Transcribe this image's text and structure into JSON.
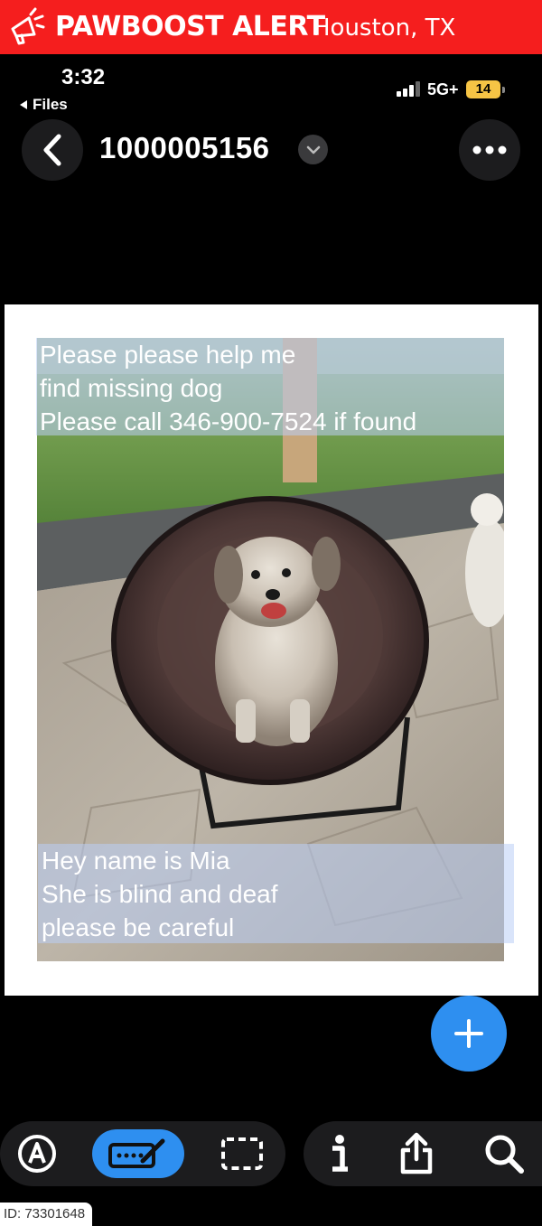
{
  "alert": {
    "title": "PAWBOOST ALERT",
    "location": "Houston, TX",
    "color": "#f51e1e"
  },
  "status_bar": {
    "time": "3:32",
    "back_label": "Files",
    "network": "5G+",
    "battery": "14"
  },
  "header": {
    "title": "1000005156",
    "icons": [
      "back-chevron-icon",
      "chevron-down-icon",
      "more-icon"
    ]
  },
  "flyer": {
    "top_caption": "Please please help me\nfind missing dog\nPlease call 346-900-7524 if found",
    "bottom_caption": "Hey name is Mia\nShe is blind and deaf\nplease be careful"
  },
  "fab": {
    "icon": "plus-icon",
    "color": "#2e8ff0"
  },
  "toolbar": {
    "left_tools": [
      "auto-markup-icon",
      "markup-icon",
      "select-icon"
    ],
    "right_tools": [
      "info-icon",
      "share-icon",
      "search-icon"
    ],
    "active_tool": "markup-icon"
  },
  "footer": {
    "id_label": "ID: 73301648"
  }
}
